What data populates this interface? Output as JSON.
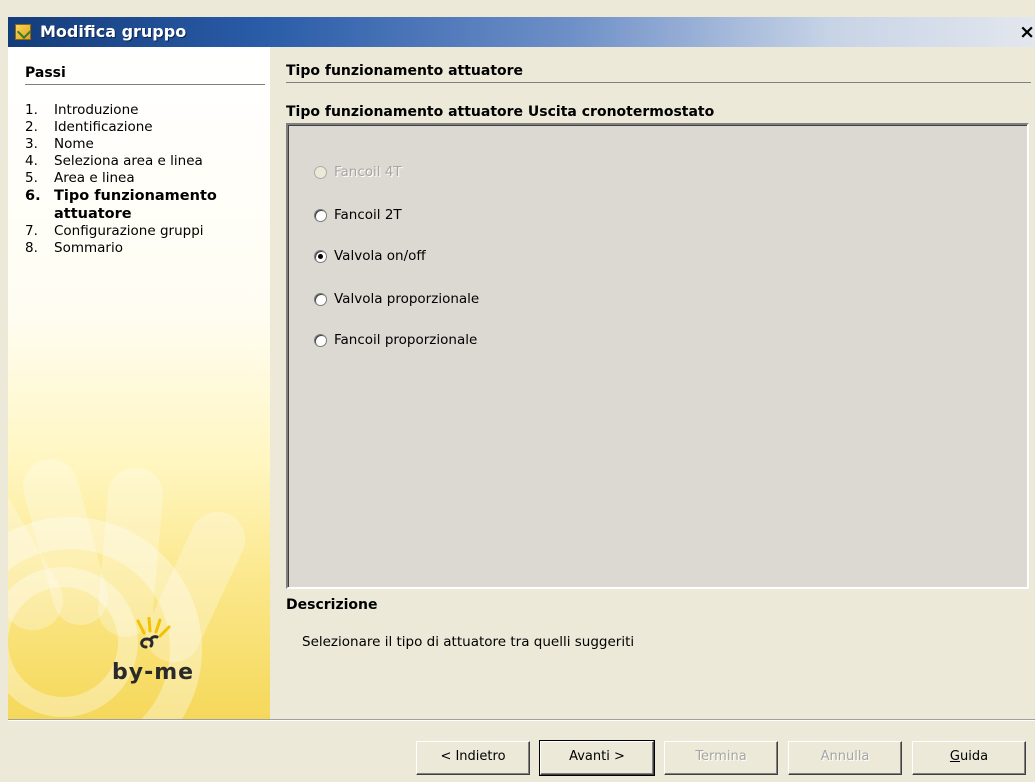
{
  "window": {
    "title": "Modifica gruppo",
    "close_glyph": "×",
    "icon": "app-icon"
  },
  "sidebar": {
    "title": "Passi",
    "steps": [
      {
        "num": "1.",
        "label": "Introduzione",
        "active": false
      },
      {
        "num": "2.",
        "label": "Identificazione",
        "active": false
      },
      {
        "num": "3.",
        "label": "Nome",
        "active": false
      },
      {
        "num": "4.",
        "label": "Seleziona area e linea",
        "active": false
      },
      {
        "num": "5.",
        "label": "Area e linea",
        "active": false
      },
      {
        "num": "6.",
        "label": "Tipo funzionamento attuatore",
        "active": true
      },
      {
        "num": "7.",
        "label": "Configurazione gruppi",
        "active": false
      },
      {
        "num": "8.",
        "label": "Sommario",
        "active": false
      }
    ],
    "logo_text": "by-me"
  },
  "main": {
    "section_title": "Tipo funzionamento attuatore",
    "group_title": "Tipo funzionamento attuatore Uscita cronotermostato",
    "options": [
      {
        "label": "Fancoil 4T",
        "selected": false,
        "disabled": true
      },
      {
        "label": "Fancoil 2T",
        "selected": false,
        "disabled": false
      },
      {
        "label": "Valvola on/off",
        "selected": true,
        "disabled": false
      },
      {
        "label": "Valvola proporzionale",
        "selected": false,
        "disabled": false
      },
      {
        "label": "Fancoil proporzionale",
        "selected": false,
        "disabled": false
      }
    ],
    "description_title": "Descrizione",
    "description_text": "Selezionare il tipo di attuatore tra quelli suggeriti"
  },
  "buttons": {
    "back": "< Indietro",
    "next": "Avanti >",
    "finish": "Termina",
    "cancel": "Annulla",
    "help_mnemonic": "G",
    "help_rest": "uida"
  },
  "colors": {
    "titlebar_start": "#143c7a",
    "sidebar_yellow": "#f5d85a",
    "dialog_bg": "#ece9d8"
  }
}
